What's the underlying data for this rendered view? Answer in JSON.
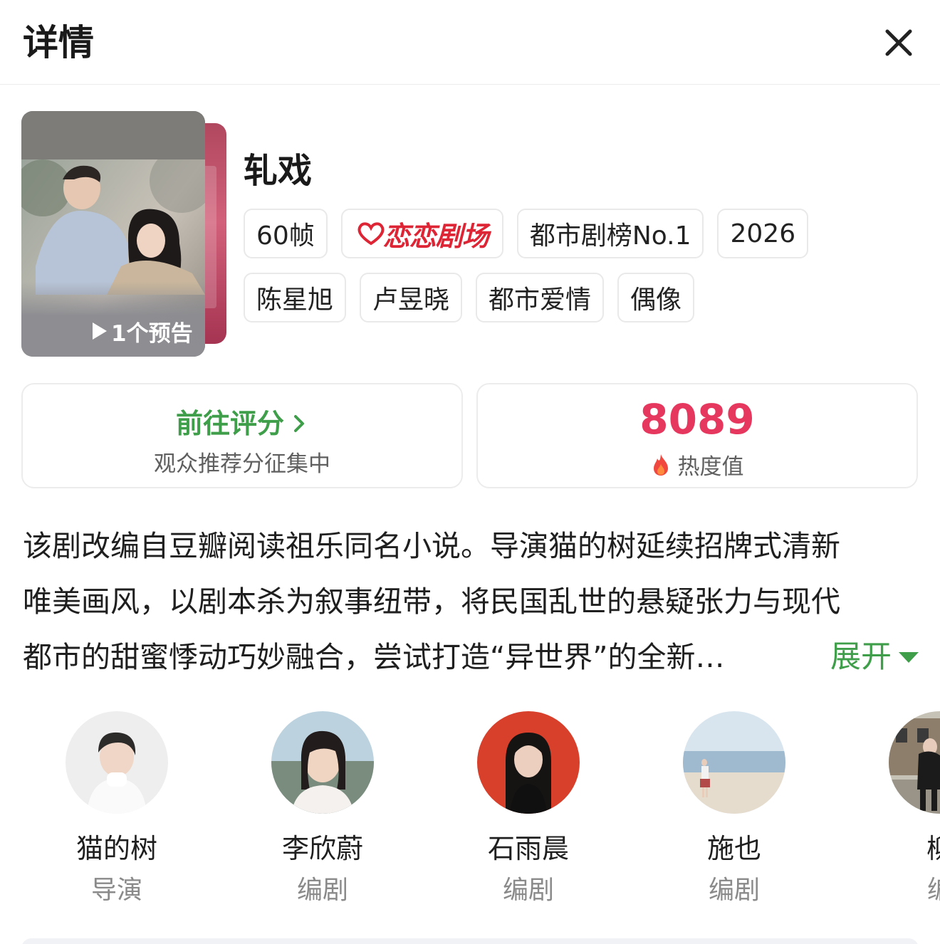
{
  "header": {
    "title": "详情"
  },
  "poster": {
    "trailer_label": "1个预告"
  },
  "show": {
    "title": "轧戏",
    "tags_row1": [
      "60帧",
      "恋恋剧场",
      "都市剧榜No.1",
      "2026"
    ],
    "tags_row2": [
      "陈星旭",
      "卢昱晓",
      "都市爱情",
      "偶像"
    ]
  },
  "rating_card": {
    "action": "前往评分",
    "subtitle": "观众推荐分征集中"
  },
  "heat_card": {
    "value": "8089",
    "label": "热度值"
  },
  "synopsis": {
    "lines": [
      "该剧改编自豆瓣阅读祖乐同名小说。导演猫的树延续招牌式清新",
      "唯美画风，以剧本杀为叙事纽带，将民国乱世的悬疑张力与现代",
      "都市的甜蜜悸动巧妙融合，尝试打造“异世界”的全新…"
    ],
    "expand_label": "展开"
  },
  "people": [
    {
      "name": "猫的树",
      "role": "导演"
    },
    {
      "name": "李欣蔚",
      "role": "编剧"
    },
    {
      "name": "石雨晨",
      "role": "编剧"
    },
    {
      "name": "施也",
      "role": "编剧"
    },
    {
      "name": "柳",
      "role": "编"
    }
  ],
  "colors": {
    "accent_green": "#3f9e4a",
    "heat_red": "#e6385e",
    "logo_red": "#dd2535"
  },
  "icons": {
    "close": "close-icon",
    "play": "play-icon",
    "chevron": "chevron-right-icon",
    "flame": "flame-icon",
    "caret": "caret-down-icon"
  }
}
